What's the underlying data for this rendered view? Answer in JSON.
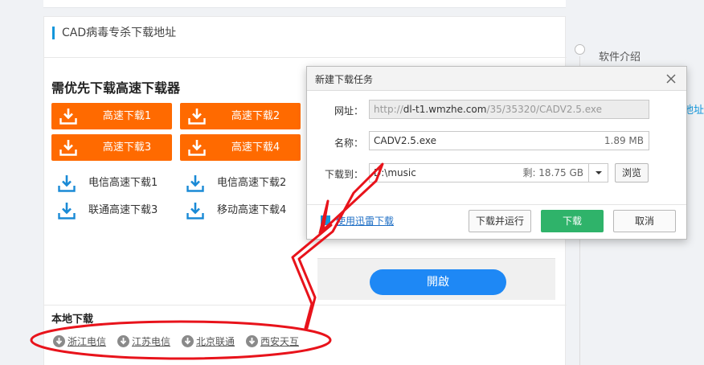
{
  "section": {
    "title": "CAD病毒专杀下载地址"
  },
  "priority": {
    "title": "需优先下载高速下载器",
    "fast_buttons": [
      "高速下载1",
      "高速下载2",
      "高速下载3",
      "高速下载4"
    ],
    "links": [
      "电信高速下载1",
      "电信高速下载2",
      "联通高速下载3",
      "移动高速下载4"
    ]
  },
  "open_button": "開啟",
  "local": {
    "title": "本地下载",
    "mirrors": [
      "浙江电信",
      "江苏电信",
      "北京联通",
      "西安天互"
    ]
  },
  "sidebar": {
    "item": "软件介绍",
    "fragment": "地址"
  },
  "dialog": {
    "title": "新建下载任务",
    "url_label": "网址：",
    "url_prefix": "http://",
    "url_domain": "dl-t1.wmzhe.com",
    "url_path": "/35/35320/CADV2.5.exe",
    "name_label": "名称：",
    "name_value": "CADV2.5.exe",
    "size": "1.89 MB",
    "save_label": "下载到：",
    "save_path": "D:\\music",
    "free_space": "剩: 18.75 GB",
    "browse": "浏览",
    "xunlei": "使用迅雷下载",
    "btn_download_run": "下载并运行",
    "btn_download": "下载",
    "btn_cancel": "取消"
  },
  "colors": {
    "orange": "#ff6a00",
    "blue": "#1e88f5",
    "green": "#2fb36a",
    "annotation": "#e8131b"
  }
}
